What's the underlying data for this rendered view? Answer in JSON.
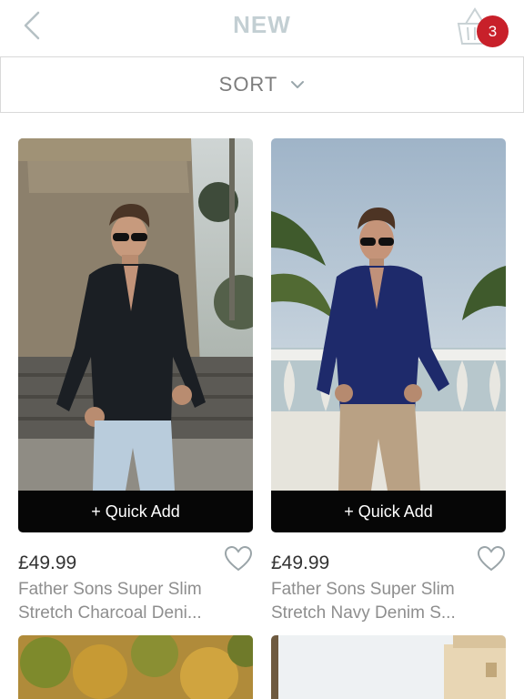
{
  "header": {
    "title": "NEW",
    "back_icon": "chevron-left-icon",
    "basket_icon": "basket-icon",
    "basket_count": "3"
  },
  "sort": {
    "label": "SORT",
    "icon": "chevron-down-icon"
  },
  "products": [
    {
      "price": "£49.99",
      "name_line1": "Father Sons Super Slim",
      "name_line2": "Stretch Charcoal Deni...",
      "quick_add": "+ Quick Add",
      "shirt_color": "#1b1f24",
      "pants_color": "#b9ccdc"
    },
    {
      "price": "£49.99",
      "name_line1": "Father Sons Super Slim",
      "name_line2": "Stretch Navy Denim S...",
      "quick_add": "+ Quick Add",
      "shirt_color": "#1e2a6b",
      "pants_color": "#b9a184"
    }
  ],
  "colors": {
    "badge": "#c8202a",
    "title": "#c3cfd3",
    "quick_add_bg": "#060606"
  }
}
